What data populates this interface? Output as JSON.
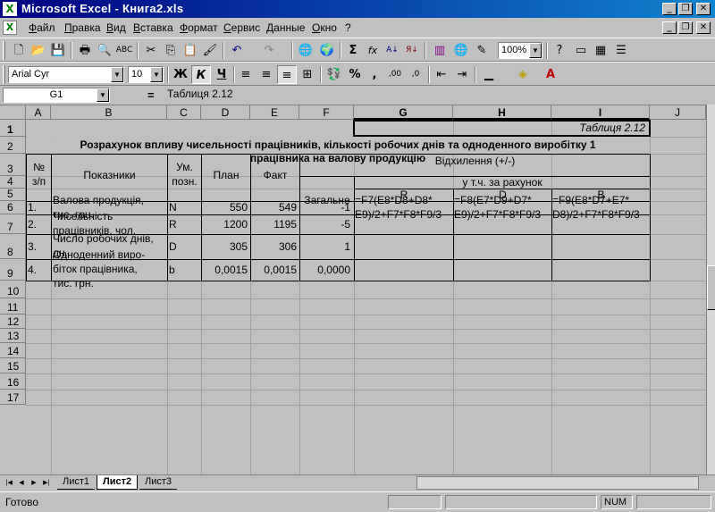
{
  "app": {
    "title": "Microsoft Excel - Книга2.xls",
    "window_buttons": [
      "_",
      "❐",
      "✕"
    ]
  },
  "menu": [
    "Файл",
    "Правка",
    "Вид",
    "Вставка",
    "Формат",
    "Сервис",
    "Данные",
    "Окно",
    "?"
  ],
  "toolbar_standard": {
    "zoom": "100%"
  },
  "toolbar_format": {
    "font_name": "Arial Cyr",
    "font_size": "10",
    "bold": "Ж",
    "italic": "К",
    "underline": "Ч",
    "percent": "%",
    "comma": ",",
    "inc_dec": ",00",
    "dec_dec": ",0",
    "sigma": "Σ",
    "fx": "fx"
  },
  "formula_bar": {
    "name_box": "G1",
    "equals": "=",
    "content": "Таблиця 2.12"
  },
  "columns": [
    "A",
    "B",
    "C",
    "D",
    "E",
    "F",
    "G",
    "H",
    "I",
    "J"
  ],
  "rows": [
    "1",
    "2",
    "3",
    "4",
    "5",
    "6",
    "7",
    "8",
    "9",
    "10",
    "11",
    "12",
    "13",
    "14",
    "15",
    "16",
    "17"
  ],
  "table": {
    "caption": "Таблиця 2.12",
    "title_line1": "Розрахунок впливу чисельності працівників, кількості робочих днів та одноденного виробітку 1",
    "title_line2": "працівника на валову продукцію",
    "hdr_num1": "№",
    "hdr_num2": "з/п",
    "hdr_indicators": "Показники",
    "hdr_unit1": "Ум.",
    "hdr_unit2": "позн.",
    "hdr_plan": "План",
    "hdr_fact": "Факт",
    "hdr_deviation": "Відхилення (+/-)",
    "hdr_total": "Загальне",
    "hdr_including": "у т.ч. за рахунок",
    "hdr_R": "R",
    "hdr_D": "D",
    "hdr_B": "B",
    "rows": [
      {
        "num": "1.",
        "name1": "Валова продукція,",
        "name2": "тис. грн.",
        "name3": "",
        "sym": "N",
        "plan": "550",
        "fact": "549",
        "total": "-1",
        "g1": "=F7(E8*D8+D8*",
        "g2": "E9)/2+F7*F8*F9/3",
        "h1": "=F8(E7*D9+D7*",
        "h2": "E9)/2+F7*F8*F9/3",
        "i1": "=F9(E8*D7+E7*",
        "i2": "D8)/2+F7*F8*F9/3"
      },
      {
        "num": "2.",
        "name1": "Чисельність",
        "name2": "працівників, чол.",
        "name3": "",
        "sym": "R",
        "plan": "1200",
        "fact": "1195",
        "total": "-5"
      },
      {
        "num": "3.",
        "name1": "Число робочих днів,",
        "name2": "дн.",
        "name3": "",
        "sym": "D",
        "plan": "305",
        "fact": "306",
        "total": "1"
      },
      {
        "num": "4.",
        "name1": "Одноденний виро-",
        "name2": "біток працівника,",
        "name3": "тис. грн.",
        "sym": "b",
        "plan": "0,0015",
        "fact": "0,0015",
        "total": "0,0000"
      }
    ]
  },
  "sheet_tabs": [
    "Лист1",
    "Лист2",
    "Лист3"
  ],
  "active_tab": "Лист2",
  "status": {
    "ready": "Готово",
    "num": "NUM"
  }
}
